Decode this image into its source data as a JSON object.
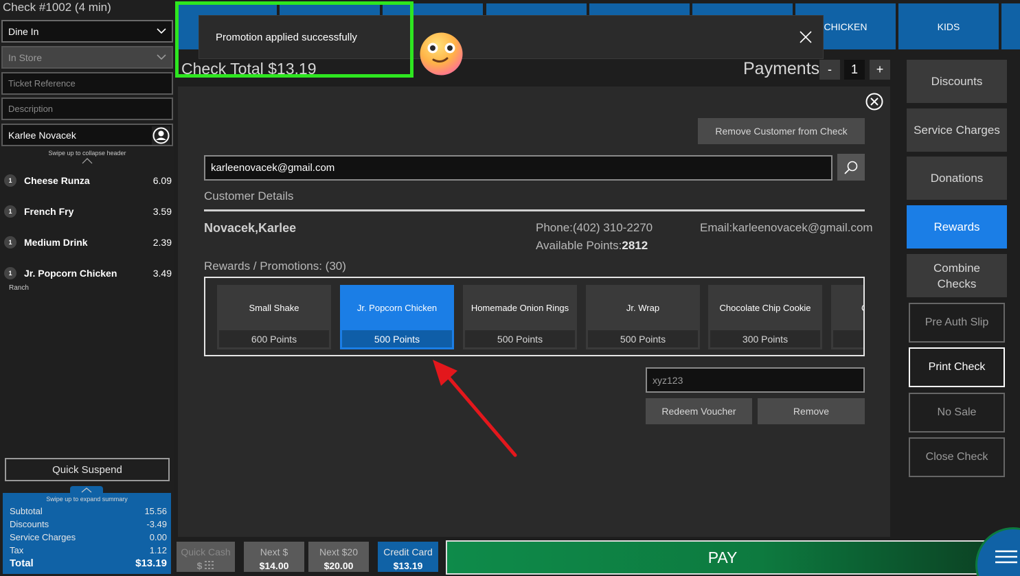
{
  "check": {
    "title": "Check #1002 (4 min)",
    "total_label": "Check Total  $13.19"
  },
  "left": {
    "order_type": "Dine In",
    "location": "In Store",
    "ticket_reference_placeholder": "Ticket Reference",
    "description_placeholder": "Description",
    "customer": "Karlee Novacek",
    "swipe_header": "Swipe up to collapse header",
    "items": [
      {
        "qty": "1",
        "name": "Cheese Runza",
        "price": "6.09",
        "mod": ""
      },
      {
        "qty": "1",
        "name": "French Fry",
        "price": "3.59",
        "mod": ""
      },
      {
        "qty": "1",
        "name": "Medium Drink",
        "price": "2.39",
        "mod": ""
      },
      {
        "qty": "1",
        "name": "Jr. Popcorn Chicken",
        "price": "3.49",
        "mod": "Ranch"
      }
    ],
    "quick_suspend": "Quick Suspend",
    "swipe_summary": "Swipe up to expand summary",
    "summary": [
      {
        "label": "Subtotal",
        "value": "15.56"
      },
      {
        "label": "Discounts",
        "value": "-3.49"
      },
      {
        "label": "Service Charges",
        "value": "0.00"
      },
      {
        "label": "Tax",
        "value": "1.12"
      },
      {
        "label": "Total",
        "value": "$13.19"
      }
    ]
  },
  "top_tabs": {
    "chicken": "CHICKEN",
    "kids": "KIDS"
  },
  "toast": {
    "message": "Promotion applied successfully"
  },
  "payments": {
    "label": "Payments",
    "minus": "-",
    "count": "1",
    "plus": "+"
  },
  "right": {
    "buttons": [
      "Discounts",
      "Service Charges",
      "Donations",
      "Rewards",
      "Combine Checks"
    ],
    "outline_buttons": [
      "Pre Auth Slip",
      "Print Check",
      "No Sale",
      "Close Check"
    ]
  },
  "modal": {
    "remove_customer": "Remove Customer from Check",
    "email_value": "karleenovacek@gmail.com",
    "customer_details_label": "Customer Details",
    "customer_name": "Novacek,Karlee",
    "phone": "Phone:(402) 310-2270",
    "points_label": "Available Points:",
    "points_value": "2812",
    "email_display": "Email:karleenovacek@gmail.com",
    "rewards_label": "Rewards / Promotions: (30)",
    "rewards": [
      {
        "name": "Small Shake",
        "points": "600 Points"
      },
      {
        "name": "Jr. Popcorn Chicken",
        "points": "500 Points"
      },
      {
        "name": "Homemade Onion Rings",
        "points": "500 Points"
      },
      {
        "name": "Jr. Wrap",
        "points": "500 Points"
      },
      {
        "name": "Chocolate Chip Cookie",
        "points": "300 Points"
      },
      {
        "name": "C",
        "points": ""
      }
    ],
    "voucher_value": "xyz123",
    "redeem_voucher": "Redeem Voucher",
    "remove": "Remove"
  },
  "bottom": {
    "quick_cash": {
      "label": "Quick Cash",
      "value": "$"
    },
    "next_dollar": {
      "label": "Next $",
      "value": "$14.00"
    },
    "next_20": {
      "label": "Next $20",
      "value": "$20.00"
    },
    "credit_card": {
      "label": "Credit Card",
      "value": "$13.19"
    },
    "pay": "PAY"
  },
  "colors": {
    "accent_blue": "#1062a6",
    "active_blue": "#1b7ee6",
    "pay_green": "#0e8b4a",
    "highlight_green": "#2ee620",
    "arrow_red": "#e3171c"
  }
}
